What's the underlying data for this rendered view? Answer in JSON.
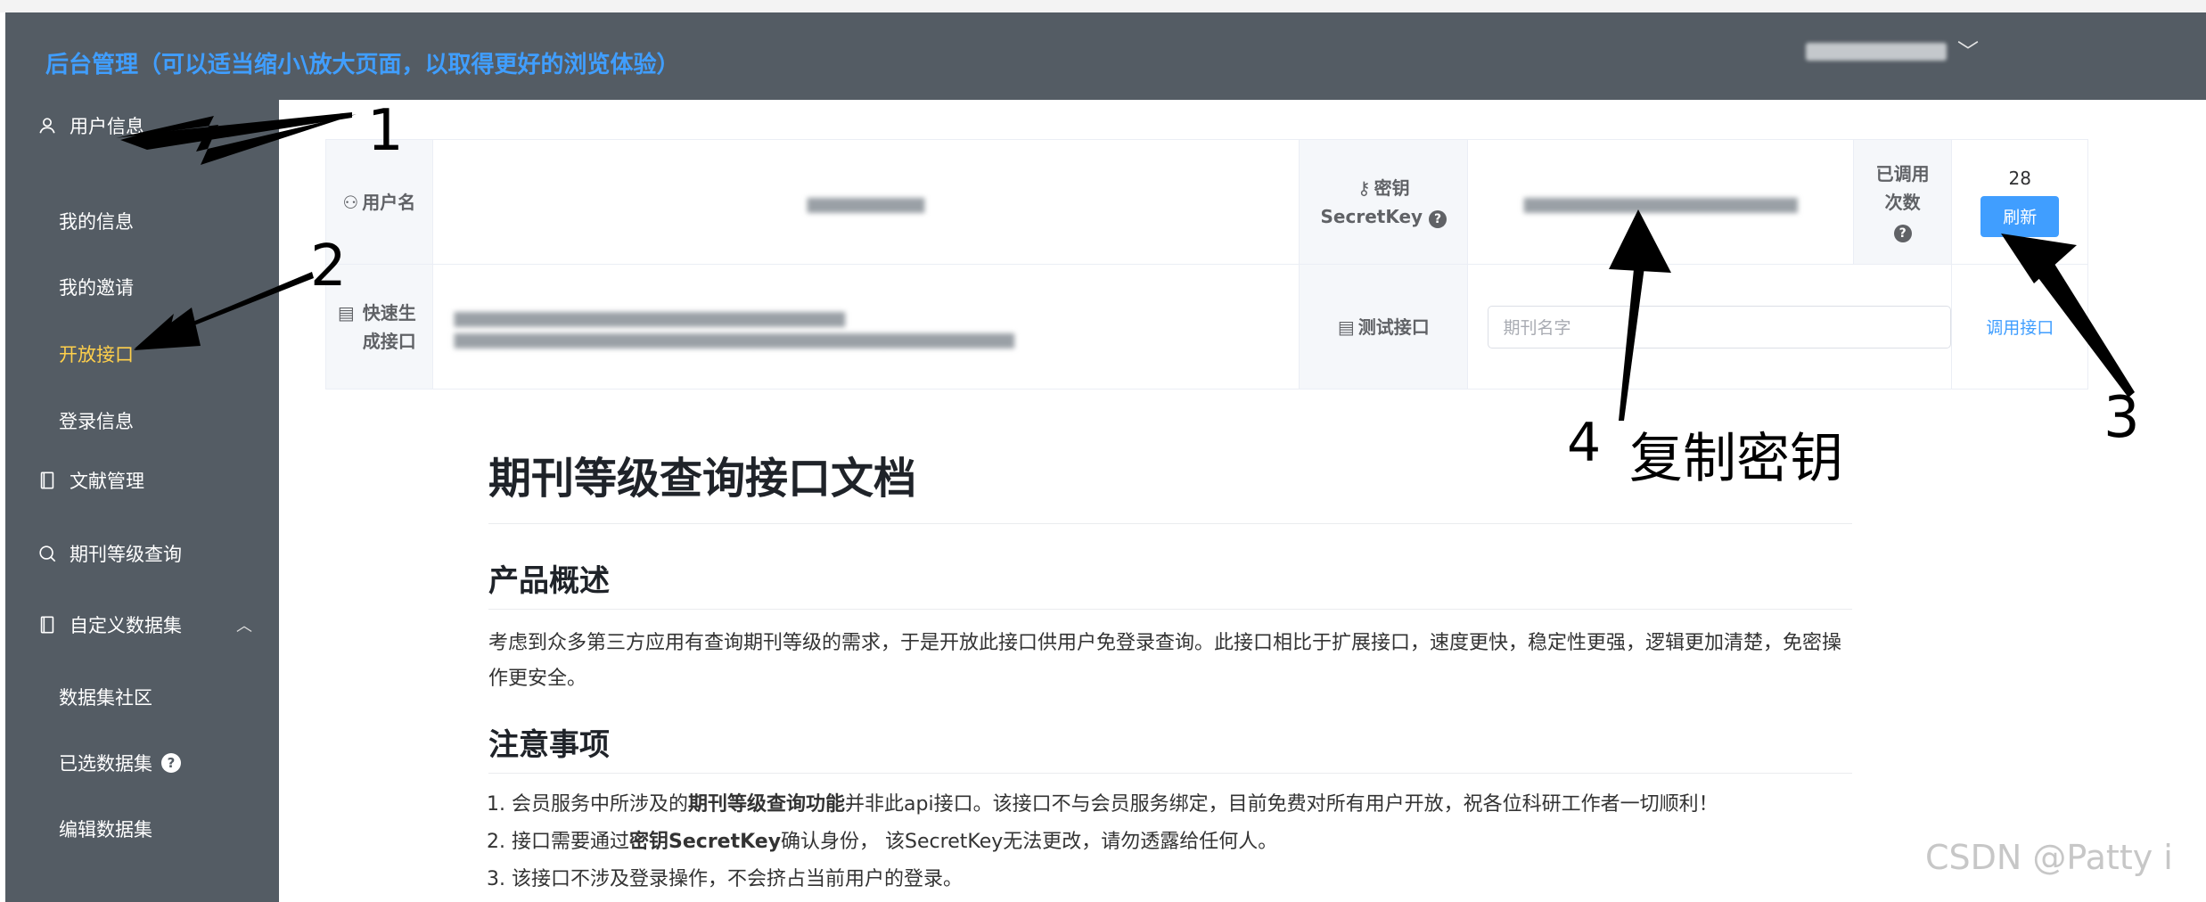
{
  "header": {
    "title": "后台管理（可以适当缩小\\放大页面，以取得更好的浏览体验）",
    "user_chevron": "﹀"
  },
  "sidebar": {
    "user_info": "用户信息",
    "my_info": "我的信息",
    "my_invite": "我的邀请",
    "open_api": "开放接口",
    "login_info": "登录信息",
    "literature": "文献管理",
    "journal_query": "期刊等级查询",
    "custom_dataset": "自定义数据集",
    "dataset_community": "数据集社区",
    "selected_dataset": "已选数据集",
    "edit_dataset": "编辑数据集",
    "help_mark": "?"
  },
  "api_table": {
    "username_label": "用户名",
    "secret_label_1": "密钥",
    "secret_label_2": "SecretKey",
    "calls_label": "已调用次数",
    "calls_count": "28",
    "refresh_button": "刷新",
    "quick_label": "快速生成接口",
    "test_label": "测试接口",
    "test_placeholder": "期刊名字",
    "call_link": "调用接口",
    "help_mark": "?"
  },
  "doc": {
    "title": "期刊等级查询接口文档",
    "overview_heading": "产品概述",
    "overview_text": "考虑到众多第三方应用有查询期刊等级的需求，于是开放此接口供用户免登录查询。此接口相比于扩展接口，速度更快，稳定性更强，逻辑更加清楚，免密操作更安全。",
    "notes_heading": "注意事项",
    "note1_a": "会员服务中所涉及的",
    "note1_b": "期刊等级查询功能",
    "note1_c": "并非此api接口。该接口不与会员服务绑定，目前免费对所有用户开放，祝各位科研工作者一切顺利！",
    "note2_a": "接口需要通过",
    "note2_b": "密钥SecretKey",
    "note2_c": "确认身份， 该SecretKey无法更改，请勿透露给任何人。",
    "note3": "该接口不涉及登录操作，不会挤占当前用户的登录。"
  },
  "annotations": {
    "n1": "1",
    "n2": "2",
    "n3": "3",
    "n4": "4",
    "copy_key": "复制密钥"
  },
  "watermark": "CSDN @Patty i",
  "colors": {
    "sidebar_bg": "#545c64",
    "accent": "#409eff",
    "active_menu": "#ffd04b"
  }
}
